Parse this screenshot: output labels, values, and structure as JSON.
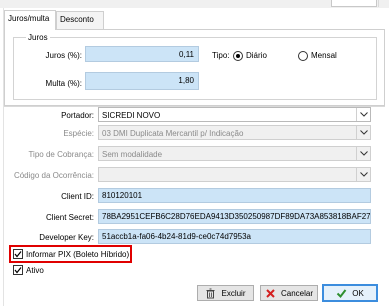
{
  "tabs": [
    {
      "label": "Juros/multa",
      "active": true
    },
    {
      "label": "Desconto",
      "active": false
    }
  ],
  "juros_group": {
    "title": "Juros",
    "juros_label": "Juros (%):",
    "juros_value": "0,11",
    "multa_label": "Multa (%):",
    "multa_value": "1,80",
    "tipo_label": "Tipo:",
    "tipo_options": [
      {
        "label": "Diário",
        "selected": true
      },
      {
        "label": "Mensal",
        "selected": false
      }
    ]
  },
  "form": {
    "portador_label": "Portador:",
    "portador_value": "SICREDI NOVO",
    "especie_label": "Espécie:",
    "especie_value": "03 DMI Duplicata Mercantil p/ Indicação",
    "tipo_cobranca_label": "Tipo de Cobrança:",
    "tipo_cobranca_value": "Sem modalidade",
    "codigo_ocorrencia_label": "Código da Ocorrência:",
    "codigo_ocorrencia_value": "",
    "client_id_label": "Client ID:",
    "client_id_value": "810120101",
    "client_secret_label": "Client Secret:",
    "client_secret_value": "78BA2951CEFB6C28D76EDA9413D350250987DF89DA73A853818BAF27",
    "developer_key_label": "Developer Key:",
    "developer_key_value": "51accb1a-fa06-4b24-81d9-ce0c74d7953a"
  },
  "checkboxes": [
    {
      "label": "Informar PIX (Boleto Híbrido)",
      "checked": true,
      "highlighted": true
    },
    {
      "label": "Ativo",
      "checked": true,
      "highlighted": false
    }
  ],
  "buttons": {
    "excluir": "Excluir",
    "cancelar": "Cancelar",
    "ok": "OK"
  },
  "colors": {
    "input_highlight": "#cce4f7",
    "annotation_red": "#e00000",
    "cancel_icon": "#d42020",
    "ok_icon": "#2f8f2f",
    "ok_border": "#3c8dde"
  }
}
